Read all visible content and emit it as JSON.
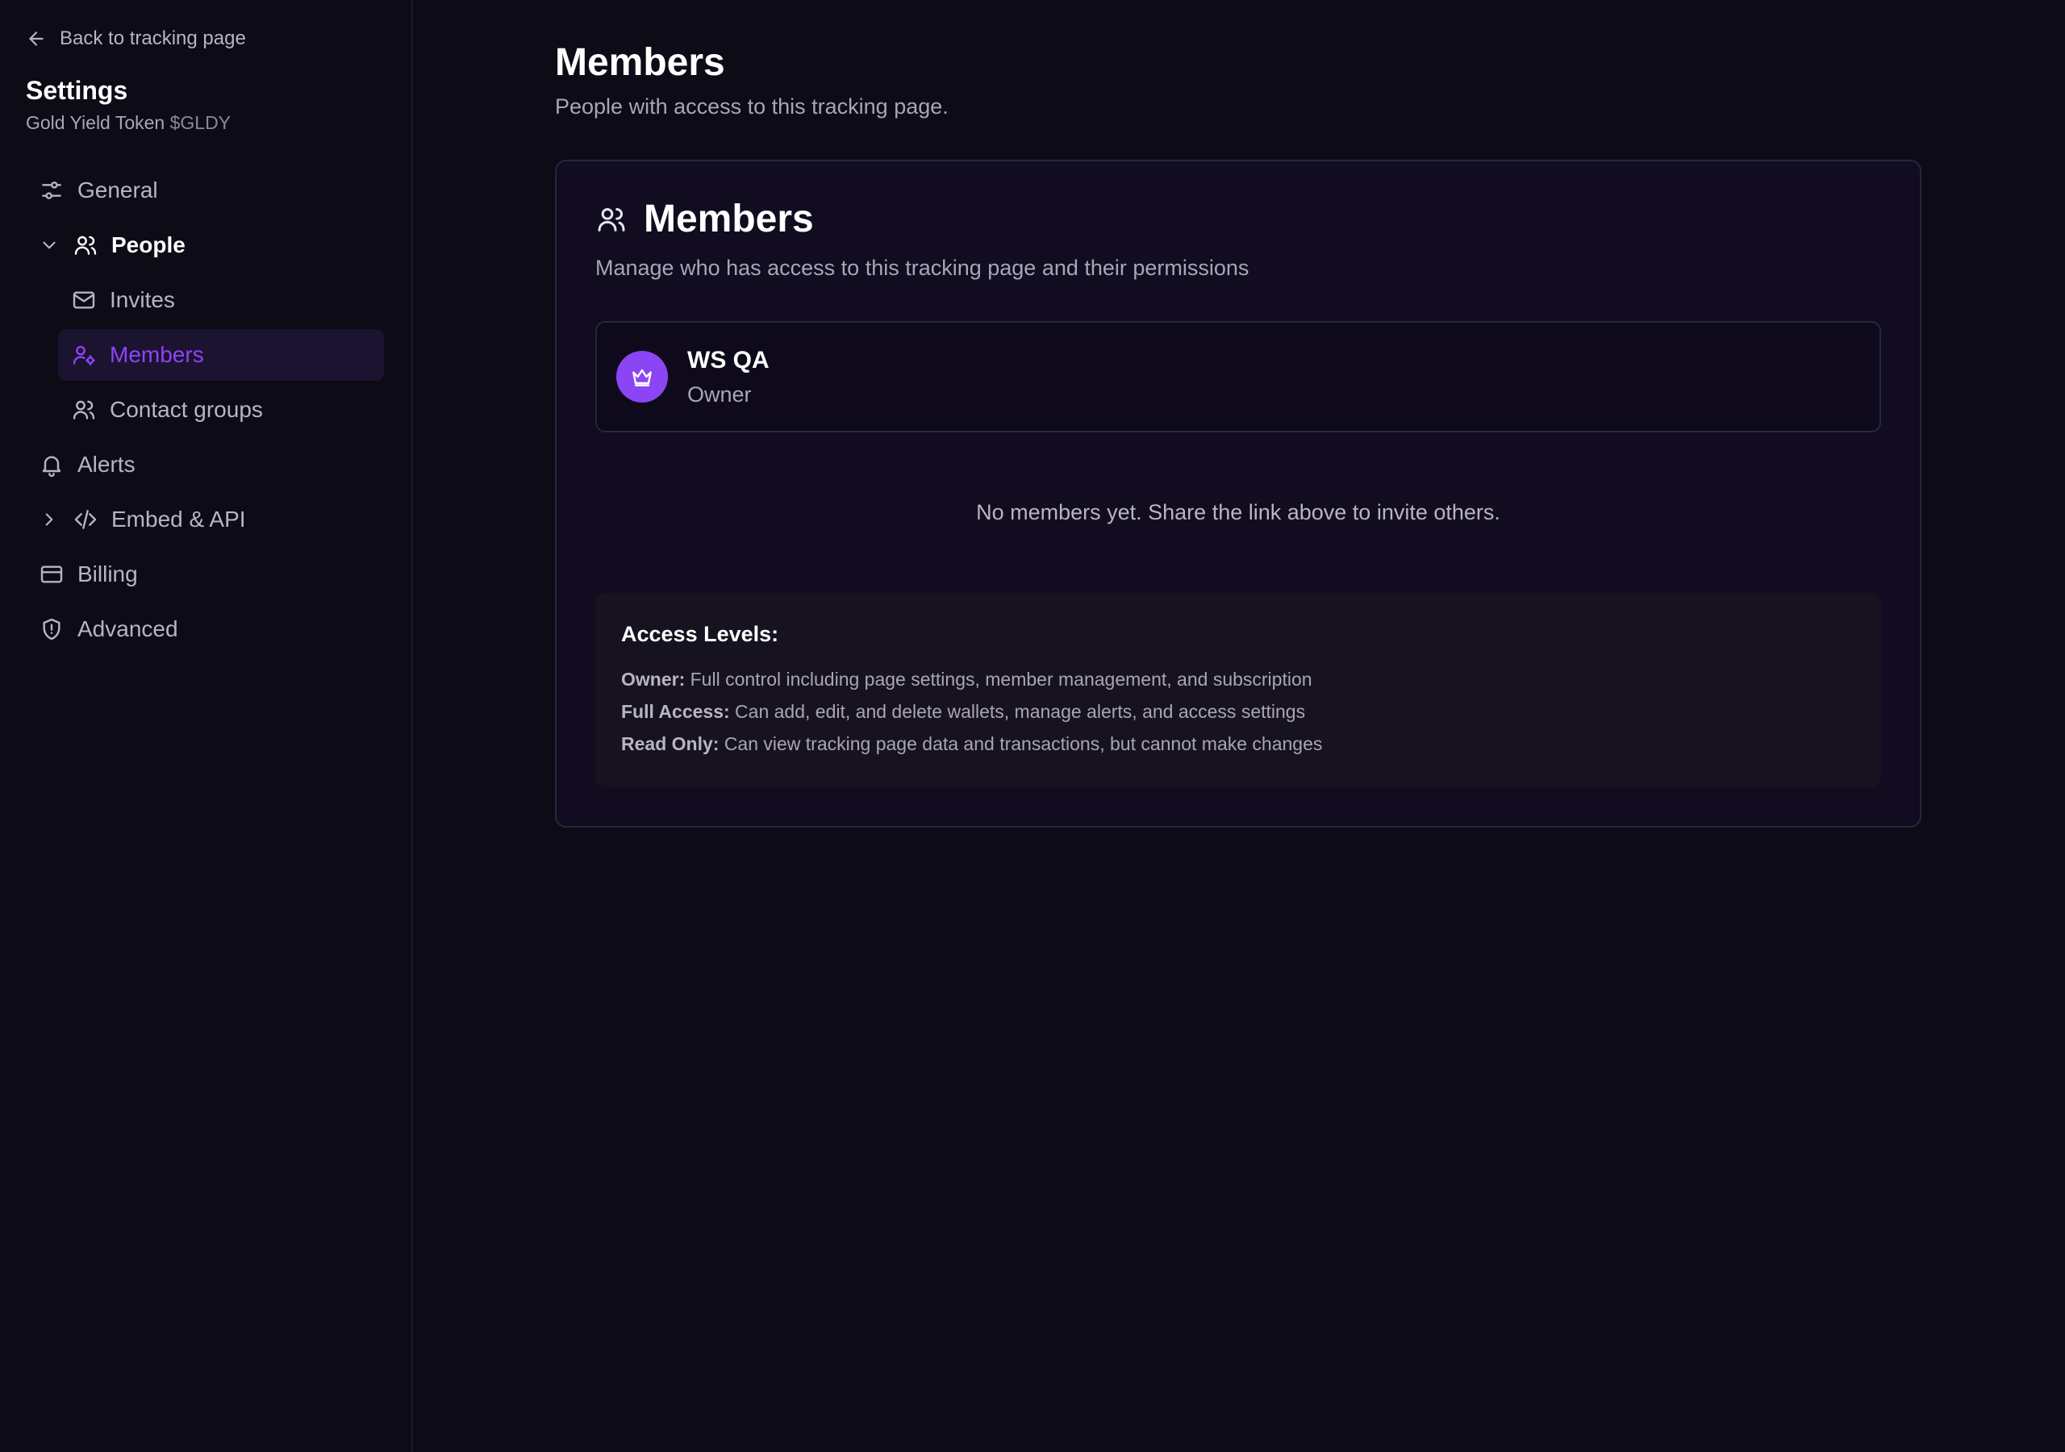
{
  "sidebar": {
    "back_label": "Back to tracking page",
    "title": "Settings",
    "project_name": "Gold Yield Token",
    "project_ticker": "$GLDY",
    "items": {
      "general": "General",
      "people": "People",
      "invites": "Invites",
      "members": "Members",
      "contact_groups": "Contact groups",
      "alerts": "Alerts",
      "embed_api": "Embed & API",
      "billing": "Billing",
      "advanced": "Advanced"
    }
  },
  "main": {
    "title": "Members",
    "subtitle": "People with access to this tracking page.",
    "card": {
      "title": "Members",
      "subtitle": "Manage who has access to this tracking page and their permissions",
      "owner": {
        "name": "WS QA",
        "role": "Owner"
      },
      "empty_message": "No members yet. Share the link above to invite others.",
      "access": {
        "title": "Access Levels:",
        "levels": [
          {
            "name": "Owner:",
            "desc": "Full control including page settings, member management, and subscription"
          },
          {
            "name": "Full Access:",
            "desc": "Can add, edit, and delete wallets, manage alerts, and access settings"
          },
          {
            "name": "Read Only:",
            "desc": "Can view tracking page data and transactions, but cannot make changes"
          }
        ]
      }
    }
  },
  "colors": {
    "background": "#0d0b16",
    "accent": "#8b45f5",
    "active_bg": "#1c1330"
  }
}
